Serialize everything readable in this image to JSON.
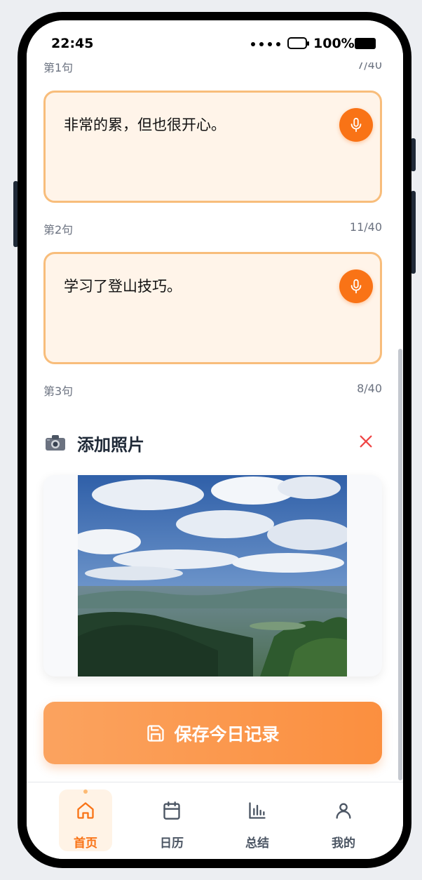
{
  "status_bar": {
    "time": "22:45",
    "battery": "100%"
  },
  "entries": [
    {
      "caption": "第1句",
      "count": "7/40"
    },
    {
      "text": "非常的累，但也很开心。",
      "caption": "第2句",
      "count": "11/40"
    },
    {
      "text": "学习了登山技巧。",
      "caption": "第3句",
      "count": "8/40"
    }
  ],
  "photo_section": {
    "title": "添加照片",
    "image_alt": "mountain-landscape-photo"
  },
  "save_button": {
    "label": "保存今日记录"
  },
  "tabs": [
    {
      "label": "首页",
      "icon": "home-icon",
      "active": true
    },
    {
      "label": "日历",
      "icon": "calendar-icon",
      "active": false
    },
    {
      "label": "总结",
      "icon": "chart-icon",
      "active": false
    },
    {
      "label": "我的",
      "icon": "user-icon",
      "active": false
    }
  ],
  "colors": {
    "accent": "#f97316",
    "entry_bg": "#fff4e9",
    "entry_border": "#f8bd7b",
    "close": "#ef4444"
  }
}
